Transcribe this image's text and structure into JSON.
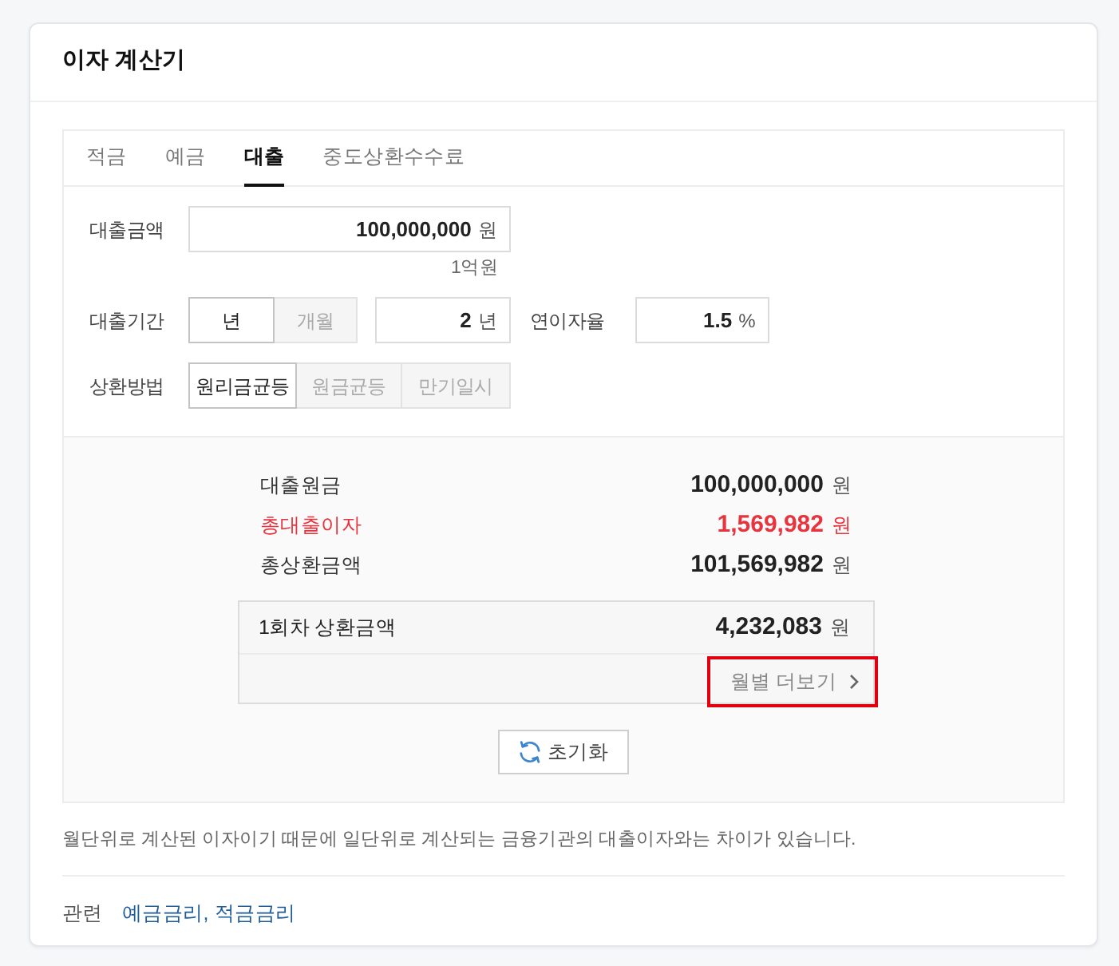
{
  "title": "이자 계산기",
  "tabs": [
    {
      "label": "적금",
      "selected": false
    },
    {
      "label": "예금",
      "selected": false
    },
    {
      "label": "대출",
      "selected": true
    },
    {
      "label": "중도상환수수료",
      "selected": false
    }
  ],
  "loan_amount": {
    "label": "대출금액",
    "value": "100,000,000",
    "unit": "원",
    "hint": "1억원"
  },
  "loan_period": {
    "label": "대출기간",
    "options": [
      {
        "label": "년",
        "selected": true
      },
      {
        "label": "개월",
        "selected": false
      }
    ],
    "value": "2",
    "unit": "년"
  },
  "interest_rate": {
    "label": "연이자율",
    "value": "1.5",
    "unit": "%"
  },
  "repayment": {
    "label": "상환방법",
    "options": [
      {
        "label": "원리금균등",
        "selected": true
      },
      {
        "label": "원금균등",
        "selected": false
      },
      {
        "label": "만기일시",
        "selected": false
      }
    ]
  },
  "results": [
    {
      "label": "대출원금",
      "value": "100,000,000",
      "unit": "원",
      "highlight": false
    },
    {
      "label": "총대출이자",
      "value": "1,569,982",
      "unit": "원",
      "highlight": true
    },
    {
      "label": "총상환금액",
      "value": "101,569,982",
      "unit": "원",
      "highlight": false
    }
  ],
  "first_payment": {
    "label": "1회차 상환금액",
    "value": "4,232,083",
    "unit": "원",
    "more_link": {
      "label": "월별 더보기",
      "highlighted": true
    }
  },
  "reset_button": {
    "label": "초기화"
  },
  "note": "월단위로 계산된 이자이기 때문에 일단위로 계산되는 금융기관의 대출이자와는 차이가 있습니다.",
  "related": {
    "label": "관련",
    "links": [
      "예금금리,",
      "적금금리"
    ]
  }
}
